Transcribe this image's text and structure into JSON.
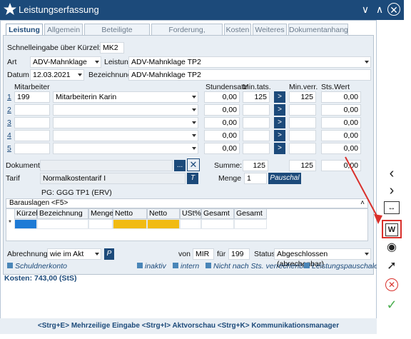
{
  "window": {
    "title": "Leistungserfassung"
  },
  "tabs": [
    {
      "label": "Leistung"
    },
    {
      "label": "Allgemein"
    },
    {
      "label": "Beteiligte Personen"
    },
    {
      "label": "Forderung, Anspruch"
    },
    {
      "label": "Kosten"
    },
    {
      "label": "Weiteres"
    },
    {
      "label": "Dokumentanhang"
    }
  ],
  "form": {
    "schnell_label": "Schnelleingabe über Kürzel:",
    "schnell_value": "MK2",
    "art_label": "Art",
    "art_value": "ADV-Mahnklage",
    "leistung_label": "Leistung",
    "leistung_value": "ADV-Mahnklage TP2",
    "datum_label": "Datum",
    "datum_value": "12.03.2021",
    "bezeichnung_label": "Bezeichnung",
    "bezeichnung_value": "ADV-Mahnklage TP2",
    "mitarbeiter_label": "Mitarbeiter",
    "stundensatz_label": "Stundensatz",
    "mintats_label": "Min.tats.",
    "minverr_label": "Min.verr.",
    "stswert_label": "Sts.Wert",
    "rows": [
      {
        "num": "1",
        "code": "199",
        "name": "Mitarbeiterin Karin",
        "rate": "0,00",
        "mintats": "125",
        "minverr": "125",
        "sts": "0,00",
        "btn": ">"
      },
      {
        "num": "2",
        "code": "",
        "name": "",
        "rate": "0,00",
        "mintats": "",
        "minverr": "",
        "sts": "0,00",
        "btn": ">"
      },
      {
        "num": "3",
        "code": "",
        "name": "",
        "rate": "0,00",
        "mintats": "",
        "minverr": "",
        "sts": "0,00",
        "btn": ">"
      },
      {
        "num": "4",
        "code": "",
        "name": "",
        "rate": "0,00",
        "mintats": "",
        "minverr": "",
        "sts": "0,00",
        "btn": ">"
      },
      {
        "num": "5",
        "code": "",
        "name": "",
        "rate": "0,00",
        "mintats": "",
        "minverr": "",
        "sts": "0,00",
        "btn": ">"
      }
    ],
    "dokument_label": "Dokument",
    "dokument_btn": "...",
    "summe_label": "Summe:",
    "summe_mintats": "125",
    "summe_minverr": "125",
    "summe_sts": "0,00",
    "tarif_label": "Tarif",
    "tarif_value": "Normalkostentarif I",
    "tarif_btn": "T",
    "menge_label": "Menge",
    "menge_value": "1",
    "pauschal_btn": "Pauschal",
    "pg_text": "PG: GGG TP1 (ERV)"
  },
  "barauslagen": {
    "title": "Barauslagen <F5>",
    "columns": [
      "Kürzel",
      "Bezeichnung",
      "Menge",
      "Netto (EL)",
      "Netto (ES)",
      "USt%",
      "Gesamt EL",
      "Gesamt ES"
    ],
    "row_marker": "*"
  },
  "bottom": {
    "abrechnung_label": "Abrechnung",
    "abrechnung_value": "wie im Akt",
    "p_btn": "P",
    "von_label": "von",
    "von_value": "MIR",
    "fuer_label": "für",
    "fuer_value": "199",
    "status_label": "Status",
    "status_value": "Abgeschlossen (abrechenbar)",
    "schuldnerkonto": "Schuldnerkonto",
    "inaktiv": "inaktiv",
    "intern": "intern",
    "nicht_sts": "Nicht nach Sts. verrechenbar",
    "leistungspauschale": "Leistungspauschale",
    "kosten": "Kosten: 743,00 (StS)"
  },
  "footer": {
    "shortcuts": "<Strg+E> Mehrzeilige Eingabe <Strg+I> Aktvorschau <Strg+K> Kommunikationsmanager"
  },
  "sidebar": [
    "chevron-left-icon",
    "chevron-right-icon",
    "expand-icon",
    "word-icon",
    "globe-icon",
    "pin-icon",
    "cancel-icon",
    "confirm-icon"
  ]
}
